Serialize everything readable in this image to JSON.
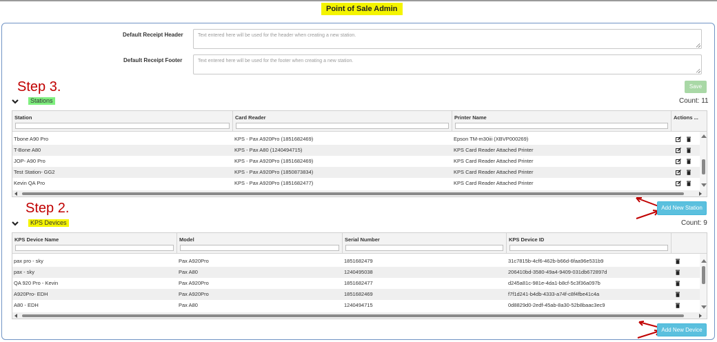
{
  "page": {
    "title": "Point of Sale Admin"
  },
  "receipt": {
    "header_label": "Default Receipt Header",
    "header_placeholder": "Text entered here will be used for the header when creating a new station.",
    "footer_label": "Default Receipt Footer",
    "footer_placeholder": "Text entered here will be used for the footer when creating a new station.",
    "save_label": "Save"
  },
  "annotations": {
    "step3": "Step 3.",
    "step2": "Step 2."
  },
  "stations": {
    "title": "Stations",
    "count_text": "Count: 11",
    "columns": [
      "Station",
      "Card Reader",
      "Printer Name",
      "Actions ..."
    ],
    "rows": [
      [
        "Tbone A90 Pro",
        "KPS - Pax A920Pro (1851682469)",
        "Epson TM-m30iii (XBVP000269)"
      ],
      [
        "T-Bone A80",
        "KPS - Pax A80 (1240494715)",
        "KPS Card Reader Attached Printer"
      ],
      [
        "JOP- A90 Pro",
        "KPS - Pax A920Pro (1851682469)",
        "KPS Card Reader Attached Printer"
      ],
      [
        "Test Station- GG2",
        "KPS - Pax A920Pro (1850873834)",
        "KPS Card Reader Attached Printer"
      ],
      [
        "Kevin QA Pro",
        "KPS - Pax A920Pro (1851682477)",
        "KPS Card Reader Attached Printer"
      ]
    ],
    "add_label": "Add New Station"
  },
  "devices": {
    "title": "KPS Devices",
    "count_text": "Count: 9",
    "columns": [
      "KPS Device Name",
      "Model",
      "Serial Number",
      "KPS Device ID"
    ],
    "rows": [
      [
        "pax pro - sky",
        "Pax A920Pro",
        "1851682479",
        "31c7815b-4cf6-462b-b66d-6faa96e531b9"
      ],
      [
        "pax - sky",
        "Pax A80",
        "1240495038",
        "206410bd-3580-49a4-9409-031db672897d"
      ],
      [
        "QA 920 Pro - Kevin",
        "Pax A920Pro",
        "1851682477",
        "d245a81c-981e-4da1-b8cf-5c3f36a097b"
      ],
      [
        "A920Pro- EDH",
        "Pax A920Pro",
        "1851682469",
        "f7f1d241-b4db-4333-a74f-c8f4fbe41c4a"
      ],
      [
        "A80 - EDH",
        "Pax A80",
        "1240494715",
        "0d8829d0-2edf-45ab-8a30-52b8baac3ec9"
      ]
    ],
    "add_label": "Add New Device"
  },
  "colors": {
    "accent_blue": "#5bc0de",
    "save_green": "#a9d8a6",
    "step_red": "#c00000",
    "highlight_yellow": "#f4f400",
    "highlight_green": "#7fef7f"
  },
  "icons": [
    "chevron-down-icon",
    "edit-icon",
    "trash-icon",
    "red-arrow-icon"
  ]
}
